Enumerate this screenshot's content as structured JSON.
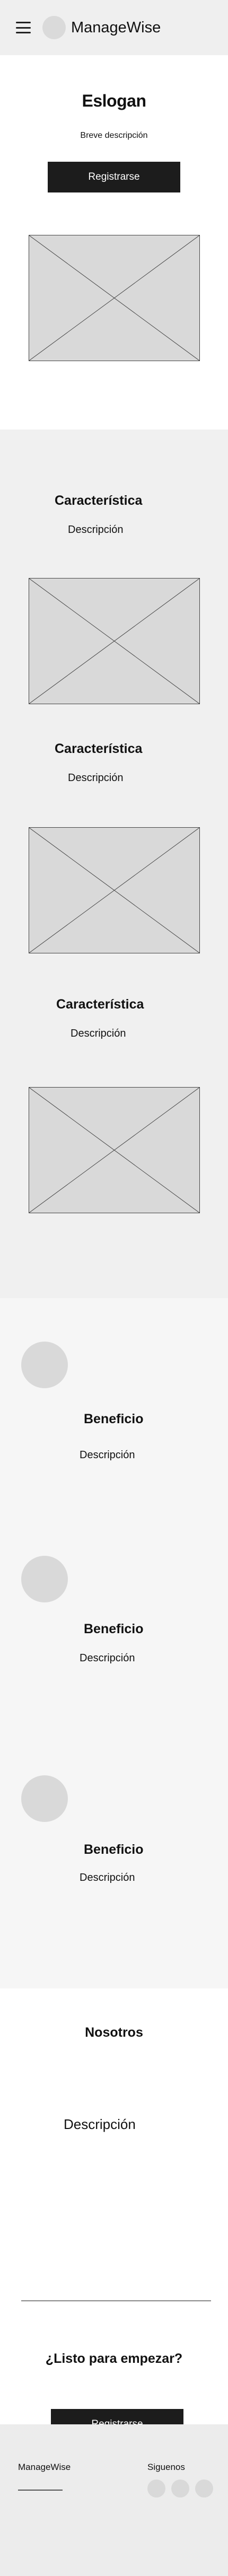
{
  "header": {
    "brand": "ManageWise",
    "menu_icon": "hamburger-menu-icon",
    "logo_icon": "logo-placeholder-circle"
  },
  "hero": {
    "slogan": "Eslogan",
    "short_description": "Breve descripción",
    "cta_label": "Registrarse",
    "image_icon": "image-placeholder-icon"
  },
  "features": [
    {
      "title": "Característica",
      "description": "Descripción",
      "image_icon": "image-placeholder-icon"
    },
    {
      "title": "Característica",
      "description": "Descripción",
      "image_icon": "image-placeholder-icon"
    },
    {
      "title": "Característica",
      "description": "Descripción",
      "image_icon": "image-placeholder-icon"
    }
  ],
  "benefits": [
    {
      "title": "Beneficio",
      "description": "Descripción",
      "icon": "benefit-circle-icon"
    },
    {
      "title": "Beneficio",
      "description": "Descripción",
      "icon": "benefit-circle-icon"
    },
    {
      "title": "Beneficio",
      "description": "Descripción",
      "icon": "benefit-circle-icon"
    }
  ],
  "about": {
    "title": "Nosotros",
    "description": "Descripción"
  },
  "cta": {
    "title": "¿Listo para empezar?",
    "button_label": "Registrarse"
  },
  "footer": {
    "brand": "ManageWise",
    "follow_label": "Siguenos",
    "social_icons": [
      "social-icon",
      "social-icon",
      "social-icon"
    ]
  },
  "colors": {
    "dark_button": "#1c1c1c",
    "placeholder_gray": "#d9d9d9",
    "header_bg": "#efefef",
    "section_bg": "#f0f0f0"
  }
}
